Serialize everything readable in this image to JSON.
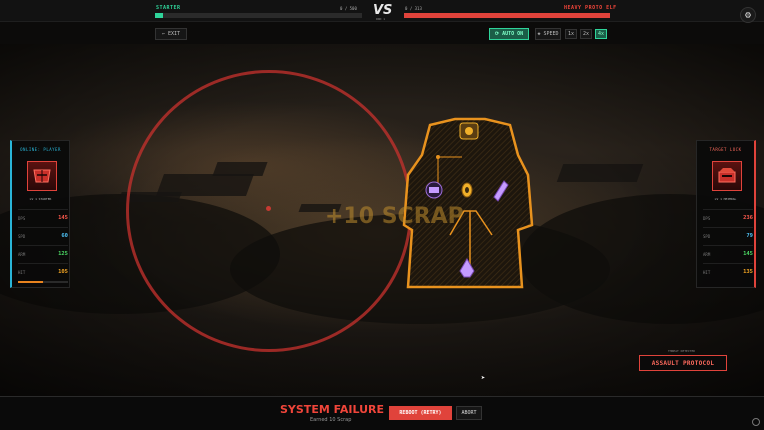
{
  "player": {
    "name": "STARTER",
    "hp_text": "0 / 500",
    "hp_fraction": 0.04,
    "color": "#2fd49a"
  },
  "enemy": {
    "name": "HEAVY PROTO ELF",
    "hp_text": "0 / 313",
    "hp_fraction": 1.0,
    "color": "#e0433b"
  },
  "versus": {
    "label": "VS",
    "round": "RND 1"
  },
  "controls": {
    "exit_label": "EXIT",
    "auto_label": "AUTO ON",
    "speed_label": "SPEED",
    "speeds": [
      "1x",
      "2x",
      "4x"
    ],
    "selected_speed": "4x"
  },
  "left_panel": {
    "title": "ONLINE: PLAYER",
    "subtitle": "LV 1 STARTER",
    "stats": [
      {
        "key": "DPS",
        "value": "145",
        "color": "#ff5a4d"
      },
      {
        "key": "SPD",
        "value": "60",
        "color": "#4fc3f7"
      },
      {
        "key": "ARM",
        "value": "125",
        "color": "#4cd964"
      },
      {
        "key": "HIT",
        "value": "105",
        "color": "#f5a623"
      }
    ],
    "xp_fraction": 0.5
  },
  "right_panel": {
    "title": "TARGET LOCK",
    "subtitle": "LV 1 HEIMDAL",
    "stats": [
      {
        "key": "DPS",
        "value": "236",
        "color": "#ff5a4d"
      },
      {
        "key": "SPD",
        "value": "79",
        "color": "#4fc3f7"
      },
      {
        "key": "ARM",
        "value": "145",
        "color": "#4cd964"
      },
      {
        "key": "HIT",
        "value": "135",
        "color": "#f5a623"
      }
    ]
  },
  "battle": {
    "floating_text": "+10 SCRAP"
  },
  "protocol": {
    "caption": "THREAT DETECTED",
    "label": "ASSAULT PROTOCOL"
  },
  "result": {
    "title": "SYSTEM FAILURE",
    "earned": "Earned 10 Scrap",
    "reboot_label": "REBOOT (RETRY)",
    "abort_label": "ABORT"
  }
}
